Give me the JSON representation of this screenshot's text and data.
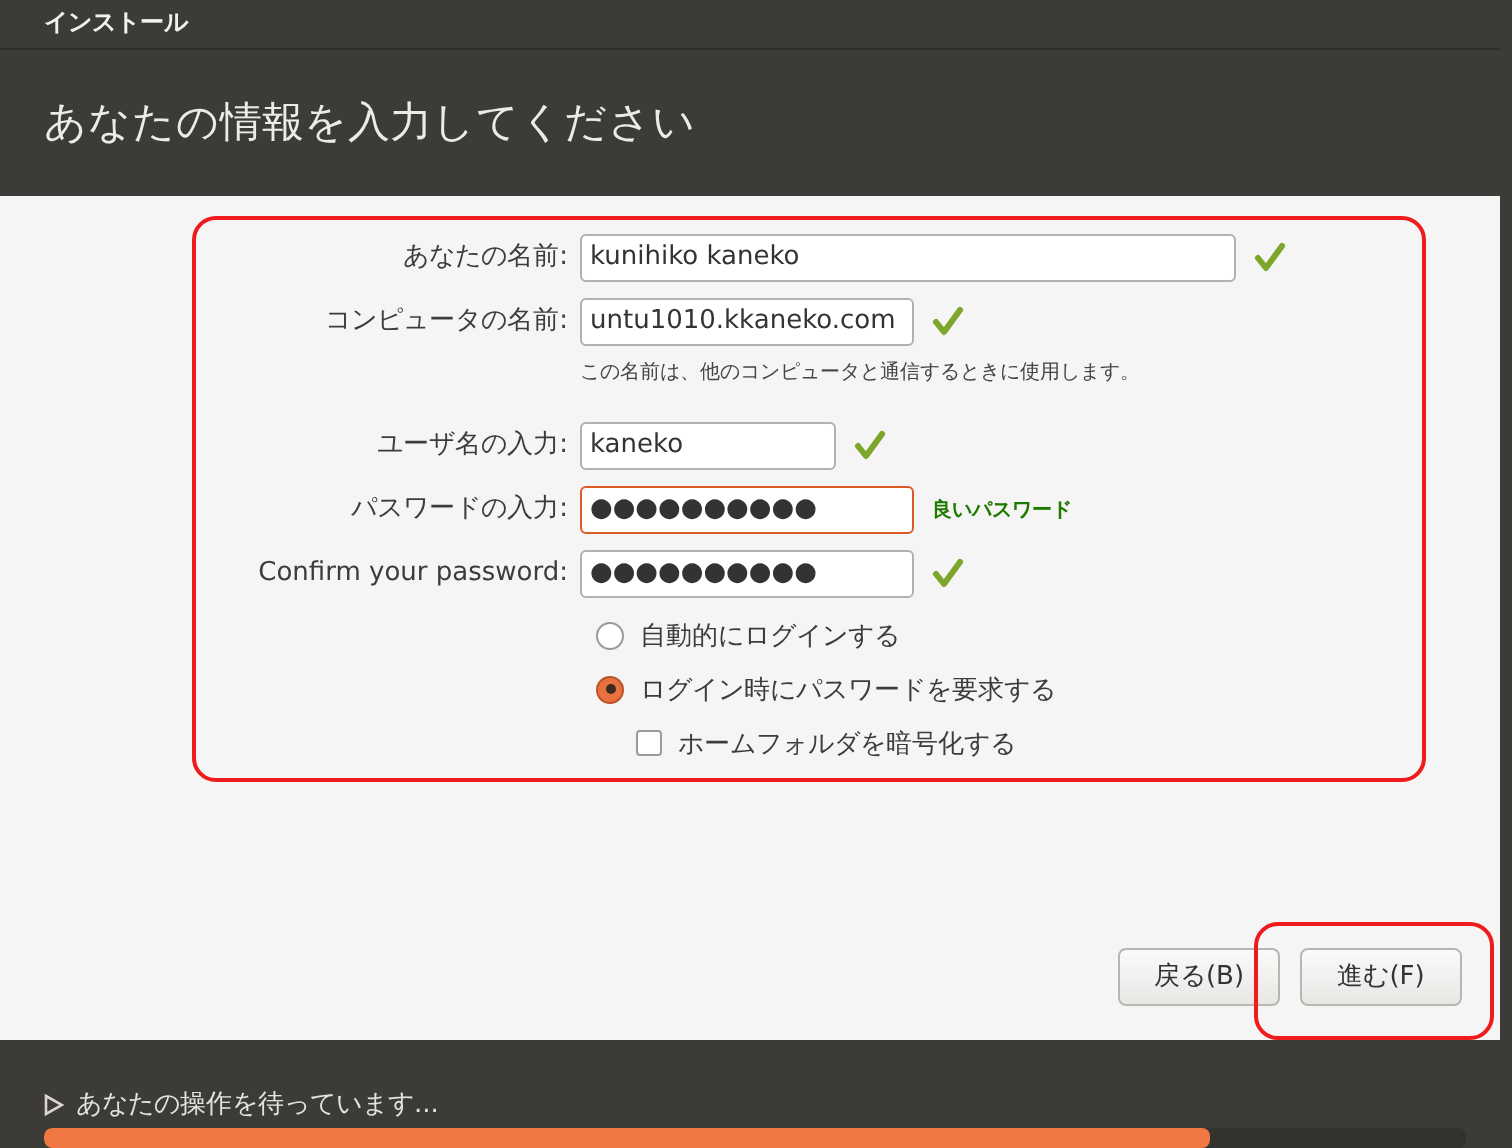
{
  "window": {
    "title": "インストール"
  },
  "header": {
    "title": "あなたの情報を入力してください"
  },
  "fields": [
    {
      "label": "あなたの名前:",
      "value": "kunihiko kaneko",
      "focused": false,
      "valid": true
    },
    {
      "label": "コンピュータの名前:",
      "value": "untu1010.kkaneko.com",
      "focused": false,
      "valid": true,
      "hint": "この名前は、他のコンピュータと通信するときに使用します。"
    },
    {
      "label": "ユーザ名の入力:",
      "value": "kaneko",
      "focused": false,
      "valid": true
    },
    {
      "label": "パスワードの入力:",
      "value": "●●●●●●●●●●",
      "focused": true,
      "valid": false,
      "strength": "良いパスワード"
    },
    {
      "label": "Confirm your password:",
      "value": "●●●●●●●●●●",
      "focused": false,
      "valid": true
    }
  ],
  "login_options": [
    {
      "kind": "radio",
      "label": "自動的にログインする",
      "selected": false
    },
    {
      "kind": "radio",
      "label": "ログイン時にパスワードを要求する",
      "selected": true
    },
    {
      "kind": "checkbox",
      "label": "ホームフォルダを暗号化する",
      "checked": false
    }
  ],
  "buttons": [
    {
      "label": "戻る(B)"
    },
    {
      "label": "進む(F)"
    }
  ],
  "status": {
    "text": "あなたの操作を待っています...",
    "level": 0.82
  }
}
